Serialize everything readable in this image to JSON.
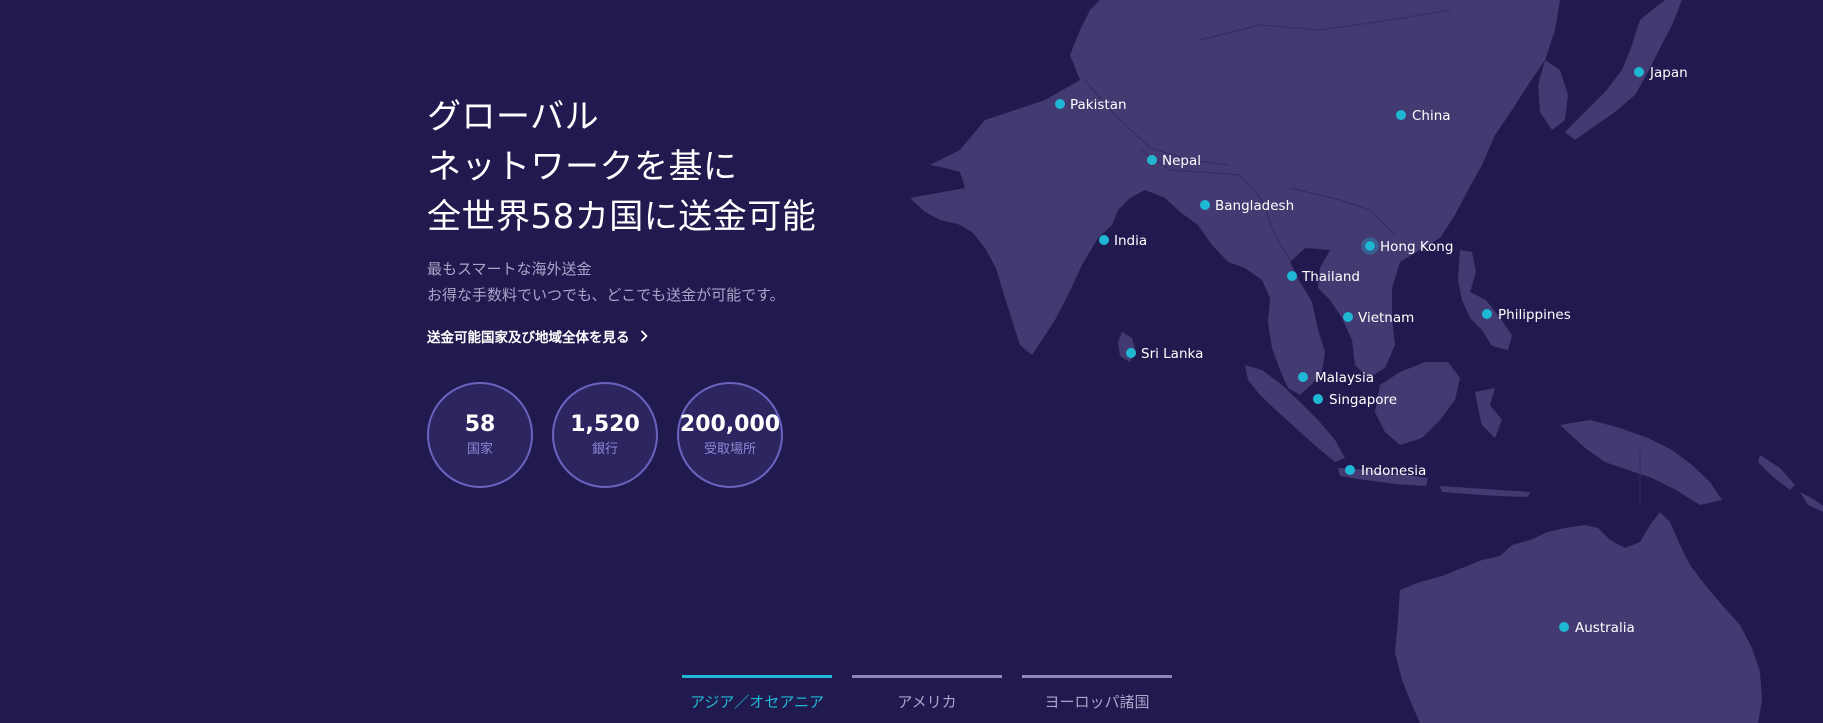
{
  "hero": {
    "title_lines": [
      "グローバル",
      "ネットワークを基に",
      "全世界58カ国に送金可能"
    ],
    "subtitle_lines": [
      "最もスマートな海外送金",
      "お得な手数料でいつでも、どこでも送金が可能です。"
    ],
    "link_label": "送金可能国家及び地域全体を見る",
    "link_icon": "chevron-right-icon"
  },
  "stats": [
    {
      "value": "58",
      "label": "国家"
    },
    {
      "value": "1,520",
      "label": "銀行"
    },
    {
      "value": "200,000",
      "label": "受取場所"
    }
  ],
  "map": {
    "land_color": "#433a72",
    "marker_color": "#1fb8d4",
    "markers": [
      {
        "id": "pakistan",
        "name": "Pakistan"
      },
      {
        "id": "nepal",
        "name": "Nepal"
      },
      {
        "id": "bangladesh",
        "name": "Bangladesh"
      },
      {
        "id": "india",
        "name": "India"
      },
      {
        "id": "sri-lanka",
        "name": "Sri Lanka"
      },
      {
        "id": "china",
        "name": "China"
      },
      {
        "id": "japan",
        "name": "Japan"
      },
      {
        "id": "hong-kong",
        "name": "Hong Kong"
      },
      {
        "id": "thailand",
        "name": "Thailand"
      },
      {
        "id": "vietnam",
        "name": "Vietnam"
      },
      {
        "id": "philippines",
        "name": "Philippines"
      },
      {
        "id": "malaysia",
        "name": "Malaysia"
      },
      {
        "id": "singapore",
        "name": "Singapore"
      },
      {
        "id": "indonesia",
        "name": "Indonesia"
      },
      {
        "id": "australia",
        "name": "Australia"
      }
    ]
  },
  "tabs": [
    {
      "label": "アジア／オセアニア",
      "active": true
    },
    {
      "label": "アメリカ",
      "active": false
    },
    {
      "label": "ヨーロッパ諸国",
      "active": false
    }
  ],
  "colors": {
    "background": "#211a4f",
    "accent": "#1fb8d4",
    "circle_border": "#6a63bf"
  }
}
